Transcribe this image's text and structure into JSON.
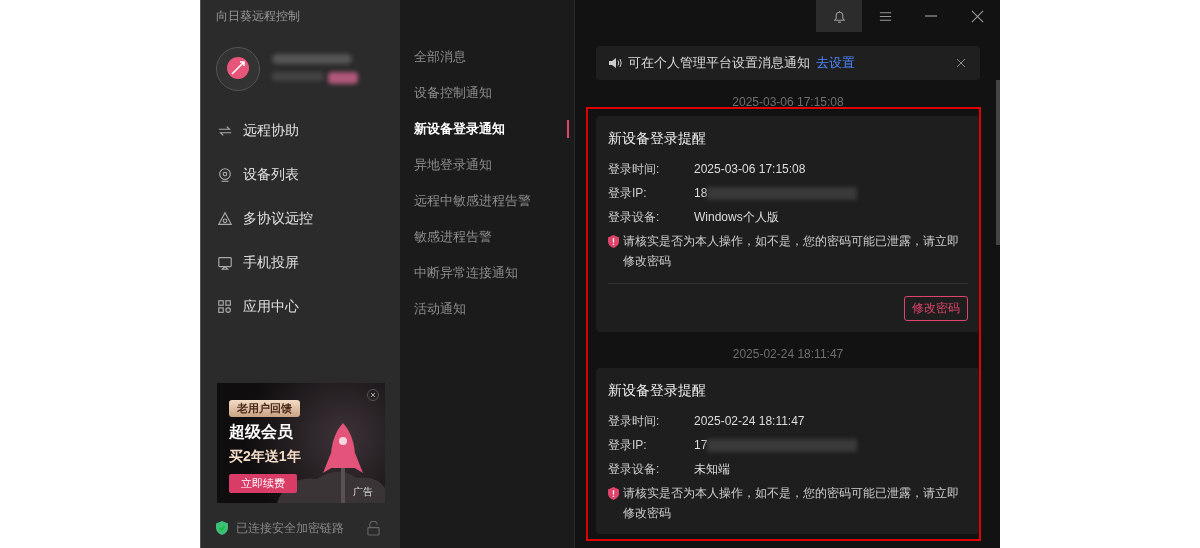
{
  "window": {
    "title": "向日葵远程控制"
  },
  "title_bar_buttons": [
    {
      "kind": "bell",
      "selected": true
    },
    {
      "kind": "menu",
      "selected": false
    },
    {
      "kind": "minimize",
      "selected": false
    },
    {
      "kind": "close",
      "selected": false
    }
  ],
  "sidebar": {
    "items": [
      {
        "label": "远程协助",
        "kind": "remote"
      },
      {
        "label": "设备列表",
        "kind": "devices"
      },
      {
        "label": "多协议远控",
        "kind": "protocol"
      },
      {
        "label": "手机投屏",
        "kind": "screen"
      },
      {
        "label": "应用中心",
        "kind": "apps"
      }
    ]
  },
  "ad": {
    "badge": "老用户回馈",
    "title": "超级会员",
    "offer": "买2年送1年",
    "button": "立即续费",
    "tag": "广告"
  },
  "status": {
    "text": "已连接安全加密链路"
  },
  "nav": {
    "items": [
      {
        "label": "全部消息",
        "selected": false
      },
      {
        "label": "设备控制通知",
        "selected": false
      },
      {
        "label": "新设备登录通知",
        "selected": true
      },
      {
        "label": "异地登录通知",
        "selected": false
      },
      {
        "label": "远程中敏感进程告警",
        "selected": false
      },
      {
        "label": "敏感进程告警",
        "selected": false
      },
      {
        "label": "中断异常连接通知",
        "selected": false
      },
      {
        "label": "活动通知",
        "selected": false
      }
    ]
  },
  "notice": {
    "text": "可在个人管理平台设置消息通知",
    "link": "去设置"
  },
  "messages": [
    {
      "time": "2025-03-06 17:15:08",
      "title": "新设备登录提醒",
      "fields": [
        {
          "label": "登录时间:",
          "value": "2025-03-06 17:15:08",
          "redacted": false
        },
        {
          "label": "登录IP:",
          "value": "18",
          "redacted": true
        },
        {
          "label": "登录设备:",
          "value": "Windows个人版",
          "redacted": false
        }
      ],
      "warning": "请核实是否为本人操作，如不是，您的密码可能已泄露，请立即修改密码",
      "action": "修改密码"
    },
    {
      "time": "2025-02-24 18:11:47",
      "title": "新设备登录提醒",
      "fields": [
        {
          "label": "登录时间:",
          "value": "2025-02-24 18:11:47",
          "redacted": false
        },
        {
          "label": "登录IP:",
          "value": "17",
          "redacted": true
        },
        {
          "label": "登录设备:",
          "value": "未知端",
          "redacted": false
        }
      ],
      "warning": "请核实是否为本人操作，如不是，您的密码可能已泄露，请立即修改密码"
    }
  ]
}
